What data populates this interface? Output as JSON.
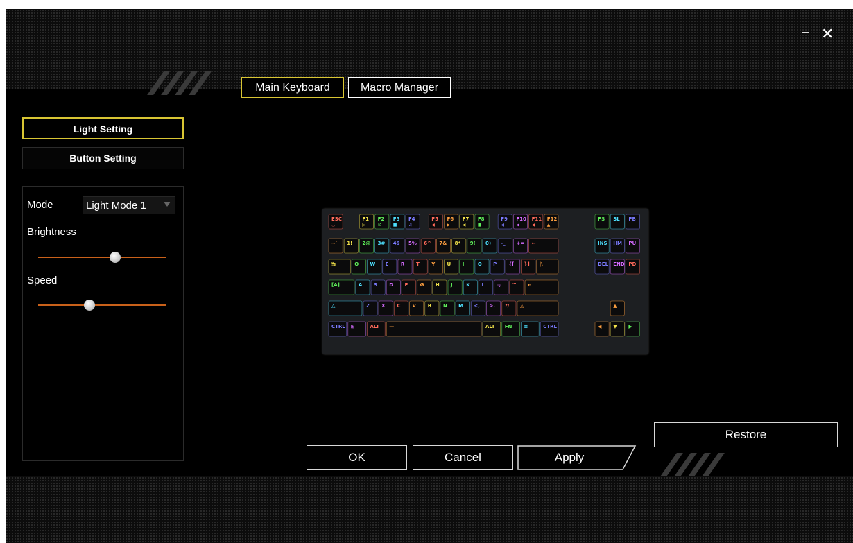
{
  "window": {
    "minimize_glyph": "–",
    "close_glyph": "✕"
  },
  "tabs": [
    {
      "label": "Main Keyboard",
      "active": true
    },
    {
      "label": "Macro Manager",
      "active": false
    }
  ],
  "sidebar": {
    "items": [
      {
        "label": "Light Setting",
        "active": true
      },
      {
        "label": "Button Setting",
        "active": false
      }
    ]
  },
  "settings": {
    "mode_label": "Mode",
    "mode_value": "Light Mode 1",
    "brightness_label": "Brightness",
    "brightness_value": 0.6,
    "speed_label": "Speed",
    "speed_value": 0.4
  },
  "keyboard": {
    "rows": [
      [
        {
          "l": "ESC",
          "s": "◡"
        },
        {
          "gap": 1
        },
        {
          "l": "F1",
          "s": "▷"
        },
        {
          "l": "F2",
          "s": "∅"
        },
        {
          "l": "F3",
          "s": "■"
        },
        {
          "l": "F4",
          "s": "♫"
        },
        {
          "gap": 0.5
        },
        {
          "l": "F5",
          "s": "◀"
        },
        {
          "l": "F6",
          "s": "▶"
        },
        {
          "l": "F7",
          "s": "◀"
        },
        {
          "l": "F8",
          "s": "■"
        },
        {
          "gap": 0.5
        },
        {
          "l": "F9",
          "s": "◀"
        },
        {
          "l": "F10",
          "s": "◀"
        },
        {
          "l": "F11",
          "s": "◀"
        },
        {
          "l": "F12",
          "s": "▲"
        }
      ],
      [
        {
          "l": "~`"
        },
        {
          "l": "1!"
        },
        {
          "l": "2@"
        },
        {
          "l": "3#"
        },
        {
          "l": "4$"
        },
        {
          "l": "5%"
        },
        {
          "l": "6^"
        },
        {
          "l": "7&"
        },
        {
          "l": "8*"
        },
        {
          "l": "9("
        },
        {
          "l": "0)"
        },
        {
          "l": "-_"
        },
        {
          "l": "+="
        },
        {
          "l": "←",
          "w": 2
        }
      ],
      [
        {
          "l": "↹",
          "w": 1.5
        },
        {
          "l": "Q"
        },
        {
          "l": "W"
        },
        {
          "l": "E"
        },
        {
          "l": "R"
        },
        {
          "l": "T"
        },
        {
          "l": "Y"
        },
        {
          "l": "U"
        },
        {
          "l": "I"
        },
        {
          "l": "O"
        },
        {
          "l": "P"
        },
        {
          "l": "{["
        },
        {
          "l": "}]"
        },
        {
          "l": "|\\",
          "w": 1.5
        }
      ],
      [
        {
          "l": "[A]",
          "w": 1.75
        },
        {
          "l": "A"
        },
        {
          "l": "S"
        },
        {
          "l": "D"
        },
        {
          "l": "F"
        },
        {
          "l": "G"
        },
        {
          "l": "H"
        },
        {
          "l": "J"
        },
        {
          "l": "K"
        },
        {
          "l": "L"
        },
        {
          "l": ":;"
        },
        {
          "l": "\"'"
        },
        {
          "l": "↵",
          "w": 2.25
        }
      ],
      [
        {
          "l": "△",
          "w": 2.25
        },
        {
          "l": "Z"
        },
        {
          "l": "X"
        },
        {
          "l": "C"
        },
        {
          "l": "V"
        },
        {
          "l": "B"
        },
        {
          "l": "N"
        },
        {
          "l": "M"
        },
        {
          "l": "<,"
        },
        {
          "l": ">."
        },
        {
          "l": "?/"
        },
        {
          "l": "△",
          "w": 2.75
        }
      ],
      [
        {
          "l": "CTRL",
          "w": 1.25
        },
        {
          "l": "⊞",
          "w": 1.25
        },
        {
          "l": "ALT",
          "w": 1.25
        },
        {
          "l": "—",
          "w": 6.25
        },
        {
          "l": "ALT",
          "w": 1.25
        },
        {
          "l": "FN",
          "w": 1.25
        },
        {
          "l": "≡",
          "w": 1.25
        },
        {
          "l": "CTRL",
          "w": 1.25
        }
      ]
    ],
    "nav": [
      [
        {
          "l": "PS"
        },
        {
          "l": "SL"
        },
        {
          "l": "PB"
        }
      ],
      [
        {
          "l": "INS"
        },
        {
          "l": "HM"
        },
        {
          "l": "PU"
        }
      ],
      [
        {
          "l": "DEL"
        },
        {
          "l": "END"
        },
        {
          "l": "PD"
        }
      ],
      [],
      [
        {
          "gap": 1
        },
        {
          "l": "▲"
        },
        {
          "gap": 1
        }
      ],
      [
        {
          "l": "◀"
        },
        {
          "l": "▼"
        },
        {
          "l": "▶"
        }
      ]
    ],
    "colors": [
      "#ff6a5a",
      "#ffa040",
      "#f2e24a",
      "#5ff05a",
      "#4de0ff",
      "#7b7bff",
      "#d56bff"
    ]
  },
  "buttons": {
    "restore": "Restore",
    "ok": "OK",
    "cancel": "Cancel",
    "apply": "Apply"
  },
  "accent": "#d8c533",
  "slider_color": "#c9611a"
}
